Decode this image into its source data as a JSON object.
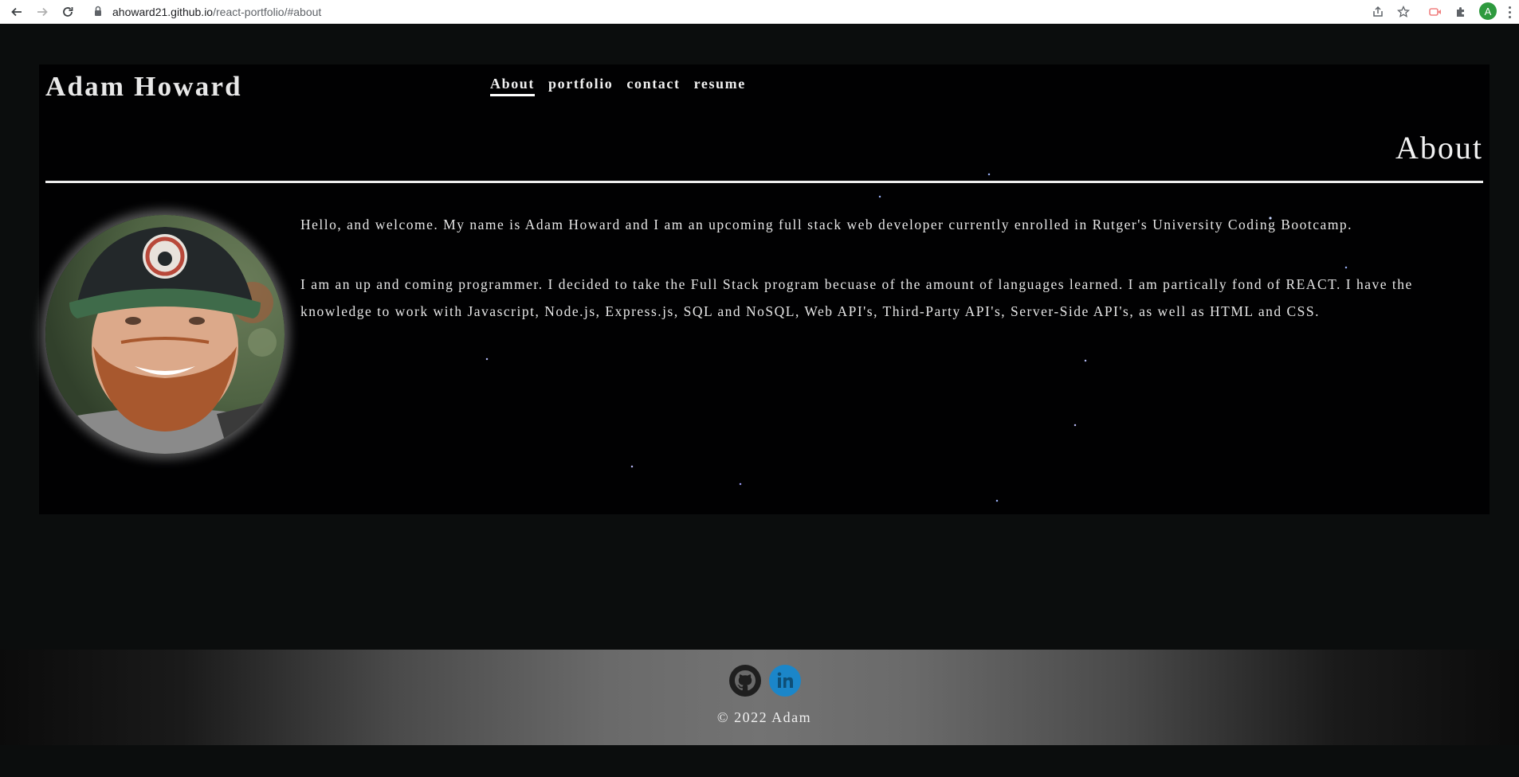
{
  "browser": {
    "url_domain": "ahoward21.github.io",
    "url_path": "/react-portfolio/#about",
    "profile_initial": "A",
    "icons": [
      "back-arrow-icon",
      "forward-arrow-icon",
      "reload-icon",
      "lock-icon",
      "share-icon",
      "bookmark-star-icon",
      "extension-icon",
      "puzzle-icon",
      "profile-avatar",
      "more-menu-icon"
    ]
  },
  "header": {
    "brand": "Adam Howard",
    "nav": [
      {
        "label": "About",
        "active": true
      },
      {
        "label": "portfolio",
        "active": false
      },
      {
        "label": "contact",
        "active": false
      },
      {
        "label": "resume",
        "active": false
      }
    ]
  },
  "about": {
    "title": "About",
    "paragraphs": [
      "Hello, and welcome. My name is Adam Howard and I am an upcoming full stack web developer currently enrolled in Rutger's University Coding Bootcamp.",
      "I am an up and coming programmer. I decided to take the Full Stack program becuase of the amount of languages learned. I am partically fond of REACT. I have the knowledge to work with Javascript, Node.js, Express.js, SQL and NoSQL, Web API's, Third-Party API's, Server-Side API's, as well as HTML and CSS."
    ],
    "photo_icon": "profile-photo"
  },
  "footer": {
    "social": [
      {
        "name": "github-icon",
        "color": "#1f1f1f"
      },
      {
        "name": "linkedin-icon",
        "color": "#1b86c9"
      }
    ],
    "copyright": "© 2022 Adam"
  },
  "colors": {
    "page_background": "#0b0d0d",
    "panel_background": "#010102",
    "text": "#e6e6e6",
    "linkedin_blue": "#1b86c9"
  }
}
